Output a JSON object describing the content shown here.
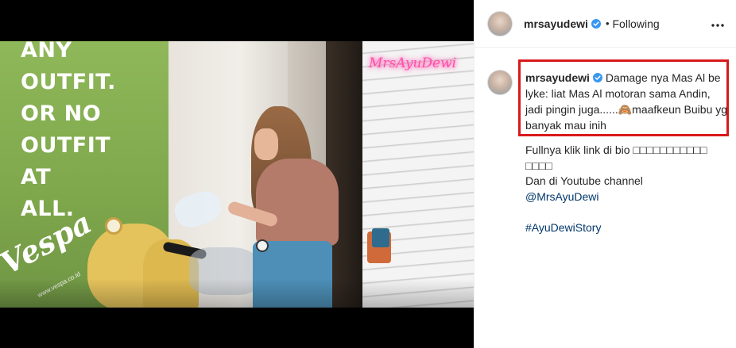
{
  "video": {
    "slogan_lines": [
      "ANY",
      "OUTFIT.",
      "OR NO",
      "OUTFIT",
      "AT",
      "ALL."
    ],
    "brand_logo": "Vespa",
    "brand_url": "www.vespa.co.id",
    "watermark": "MrsAyuDewi",
    "mute_icon": "speaker-muted-icon"
  },
  "header": {
    "username": "mrsayudewi",
    "separator": "•",
    "follow_state": "Following",
    "more_icon": "more-horizontal-icon"
  },
  "caption": {
    "username": "mrsayudewi",
    "text": "Damage nya Mas Al be lyke: liat Mas Al motoran sama Andin, jadi pingin juga......🙈maafkeun Buibu yg banyak mau inih"
  },
  "caption_extra": {
    "line1": "Fullnya klik link di bio □□□□□□□□□□□ □□□□",
    "line2": "Dan di Youtube channel",
    "mention": "@MrsAyuDewi",
    "hashtag": "#AyuDewiStory"
  },
  "colors": {
    "verified_badge": "#3897f0",
    "highlight_box": "#d7191c",
    "link": "#00376b"
  }
}
